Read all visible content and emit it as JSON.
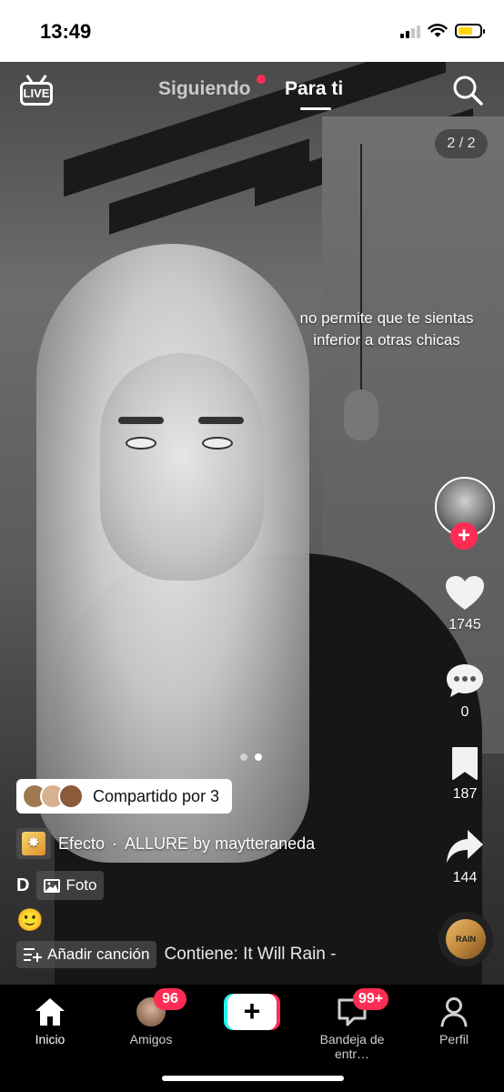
{
  "status_bar": {
    "time": "13:49"
  },
  "top_nav": {
    "live_label": "LIVE",
    "tab_following": "Siguiendo",
    "tab_for_you": "Para ti",
    "active_tab": "Para ti"
  },
  "post": {
    "image_counter": "2 / 2",
    "caption_line1": "no permite que te sientas",
    "caption_line2": "inferior a otras chicas",
    "shared_by": "Compartido por 3",
    "effect_label": "Efecto",
    "effect_name": "ALLURE by maytteraneda",
    "effect_separator": "·",
    "username": "D",
    "photo_label": "Foto",
    "emoji": "🙂",
    "add_song_label": "Añadir canción",
    "song_text": "Contiene: It Will Rain -",
    "music_disc_text": "RAIN"
  },
  "sidebar": {
    "follow_symbol": "+",
    "likes": "1745",
    "comments": "0",
    "saves": "187",
    "shares": "144"
  },
  "bottom_tabs": {
    "home": "Inicio",
    "friends": "Amigos",
    "friends_badge": "96",
    "create_symbol": "+",
    "inbox": "Bandeja de entr…",
    "inbox_badge": "99+",
    "profile": "Perfil"
  },
  "colors": {
    "accent_red": "#fe2c55",
    "accent_cyan": "#25f4ee",
    "battery_yellow": "#ffd60a"
  }
}
